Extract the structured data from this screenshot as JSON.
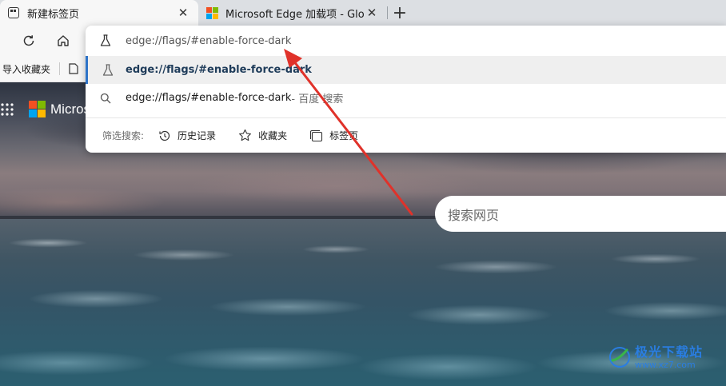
{
  "tabs": [
    {
      "title": "新建标签页",
      "active": true,
      "close": "✕"
    },
    {
      "title": "Microsoft Edge 加载项 - Global S",
      "active": false,
      "close": "✕"
    }
  ],
  "new_tab_symbol": "+",
  "favorites_bar": {
    "items": [
      {
        "label": "导入收藏夹",
        "icon": "import-icon"
      },
      {
        "label": "",
        "icon": "page-icon"
      }
    ]
  },
  "omnibox": {
    "input_value": "edge://flags/#enable-force-dark",
    "suggestions": [
      {
        "text": "edge://flags/#enable-force-dark",
        "icon": "flask-icon",
        "selected": true
      },
      {
        "text": "edge://flags/#enable-force-dark",
        "suffix": " - 百度 搜索",
        "icon": "search-icon",
        "selected": false
      }
    ],
    "filter_label": "筛选搜索:",
    "filters": [
      {
        "label": "历史记录",
        "icon": "history-icon"
      },
      {
        "label": "收藏夹",
        "icon": "star-icon"
      },
      {
        "label": "标签页",
        "icon": "tabs-icon"
      }
    ]
  },
  "new_tab_page": {
    "brand": "Micros",
    "search_placeholder": "搜索网页"
  },
  "watermark": {
    "name": "极光下载站",
    "url": "www.xz7.com"
  },
  "colors": {
    "accent": "#2d73c8",
    "annotation_arrow": "#e0322a",
    "ms_red": "#f25022",
    "ms_green": "#7fba00",
    "ms_blue": "#00a4ef",
    "ms_yellow": "#ffb900"
  }
}
